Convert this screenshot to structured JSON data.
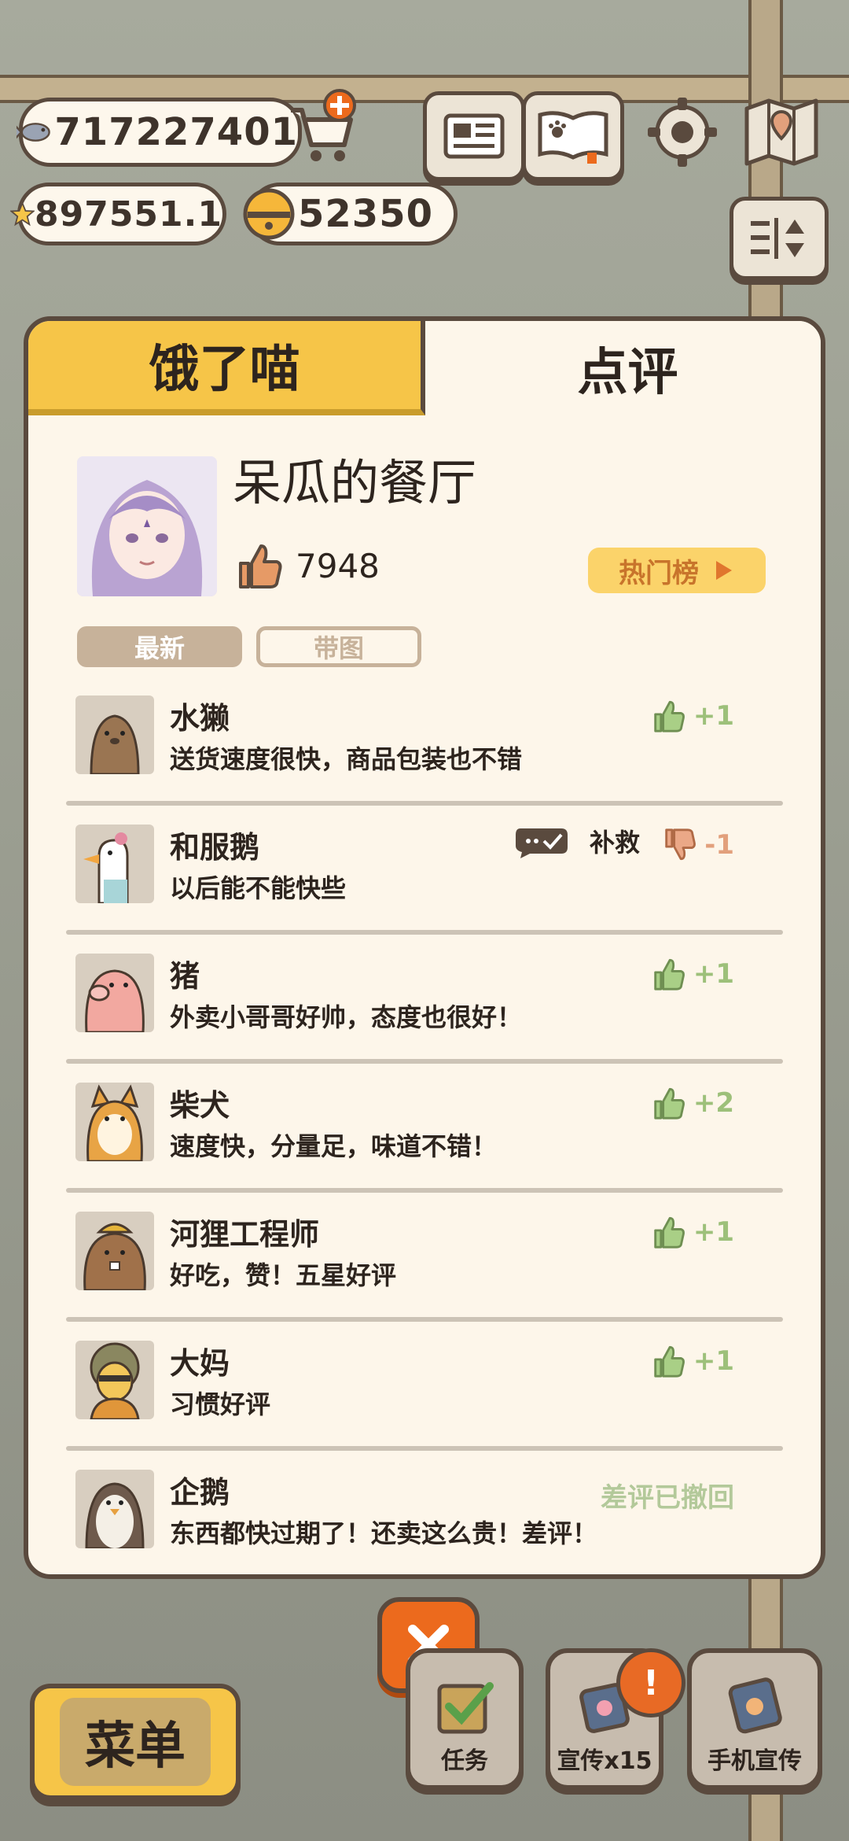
{
  "currencies": {
    "fish": "717227401",
    "star": "897551.1",
    "bell": "52350"
  },
  "top_icons": [
    "newspaper-icon",
    "paw-book-icon",
    "settings-gear-icon",
    "map-icon",
    "sort-toggle-icon"
  ],
  "tabs": [
    {
      "label": "饿了喵"
    },
    {
      "label": "点评"
    }
  ],
  "restaurant": {
    "name": "呆瓜的餐厅",
    "likes": "7948",
    "hot_button": "热门榜"
  },
  "filters": {
    "latest": "最新",
    "with_image": "带图"
  },
  "reviews": [
    {
      "name": "水獭",
      "text": "送货速度很快，商品包装也不错",
      "score": "+1",
      "type": "like",
      "avatar": "otter"
    },
    {
      "name": "和服鹅",
      "text": "以后能不能快些",
      "score": "-1",
      "type": "dislike",
      "remedy": "补救",
      "avatar": "goose"
    },
    {
      "name": "猪",
      "text": "外卖小哥哥好帅，态度也很好！",
      "score": "+1",
      "type": "like",
      "avatar": "pig"
    },
    {
      "name": "柴犬",
      "text": "速度快，分量足，味道不错！",
      "score": "+2",
      "type": "like",
      "avatar": "shiba"
    },
    {
      "name": "河狸工程师",
      "text": "好吃，赞！五星好评",
      "score": "+1",
      "type": "like",
      "avatar": "beaver"
    },
    {
      "name": "大妈",
      "text": "习惯好评",
      "score": "+1",
      "type": "like",
      "avatar": "auntie"
    },
    {
      "name": "企鹅",
      "text": "东西都快过期了！还卖这么贵！差评！",
      "status": "差评已撤回",
      "type": "withdrawn",
      "avatar": "penguin"
    }
  ],
  "bottom": {
    "menu": "菜单",
    "tasks": "任务",
    "promo": "宣传x15",
    "phone_promo": "手机宣传",
    "badge": "!"
  },
  "colors": {
    "tab_active": "#f6c548",
    "panel_bg": "#fdf6ea",
    "like_green": "#9dc07a",
    "dislike_orange": "#e2a07c",
    "close_orange": "#ec6a1d"
  }
}
